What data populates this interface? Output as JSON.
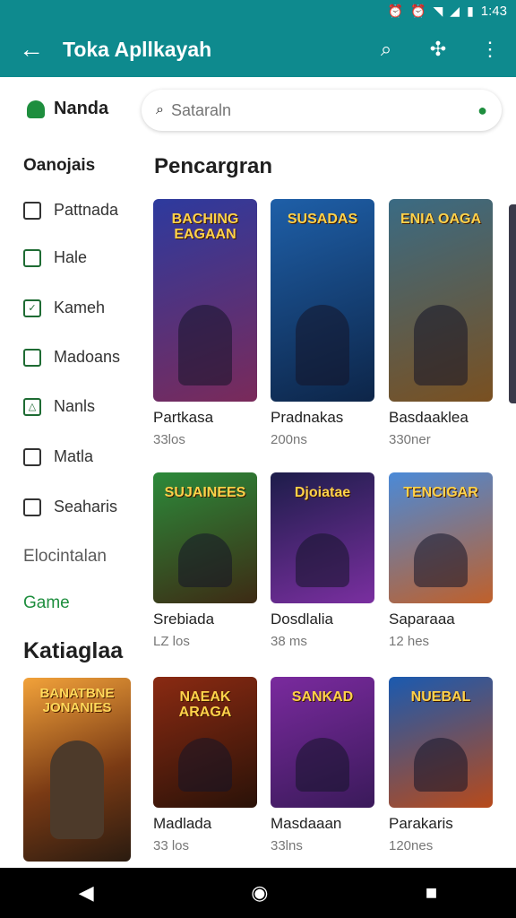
{
  "status": {
    "time": "1:43",
    "icons": [
      "alarm-icon",
      "alarm-icon",
      "wifi-icon",
      "signal-icon",
      "battery-icon"
    ]
  },
  "app_bar": {
    "title": "Toka Apllkayah"
  },
  "search": {
    "placeholder": "Sataraln"
  },
  "sidebar": {
    "user": "Nanda",
    "heading": "Oanojais",
    "items": [
      "Pattnada",
      "Hale",
      "Kameh",
      "Madoans",
      "Nanls",
      "Matla",
      "Seaharis"
    ],
    "muted": "Elocintalan",
    "game": "Game",
    "big": "Katiaglaa",
    "tile_title": "BANATBNE JONANIES"
  },
  "section": {
    "title": "Pencargran"
  },
  "cards": [
    {
      "title": "BACHING EAGAAN",
      "name": "Partkasa",
      "size": "33los",
      "colors": [
        "#2d3a9e",
        "#7a2a5a"
      ]
    },
    {
      "title": "SUSADAS",
      "name": "Pradnakas",
      "size": "200ns",
      "colors": [
        "#1e5fa8",
        "#0d2548"
      ]
    },
    {
      "title": "ENIA OAGA",
      "name": "Basdaaklea",
      "size": "330ner",
      "colors": [
        "#3a6b84",
        "#7a5020"
      ]
    },
    {
      "title": "SUJAINEES",
      "name": "Srebiada",
      "size": "LZ los",
      "colors": [
        "#2c8a3a",
        "#3d2a14"
      ]
    },
    {
      "title": "Djoiatae",
      "name": "Dosdlalia",
      "size": "38 ms",
      "colors": [
        "#1d1d4a",
        "#7a2fa0"
      ]
    },
    {
      "title": "TENCIGAR",
      "name": "Saparaaa",
      "size": "12 hes",
      "colors": [
        "#4a8ad8",
        "#c0602a"
      ]
    },
    {
      "title": "NAEAK ARAGA",
      "name": "Madlada",
      "size": "33 los",
      "colors": [
        "#8a2a12",
        "#2a1208"
      ]
    },
    {
      "title": "SANKAD",
      "name": "Masdaaan",
      "size": "33lns",
      "colors": [
        "#7a2a9e",
        "#3a1a5a"
      ]
    },
    {
      "title": "NUEBAL",
      "name": "Parakaris",
      "size": "120nes",
      "colors": [
        "#1a5ab0",
        "#b84a1a"
      ]
    }
  ]
}
